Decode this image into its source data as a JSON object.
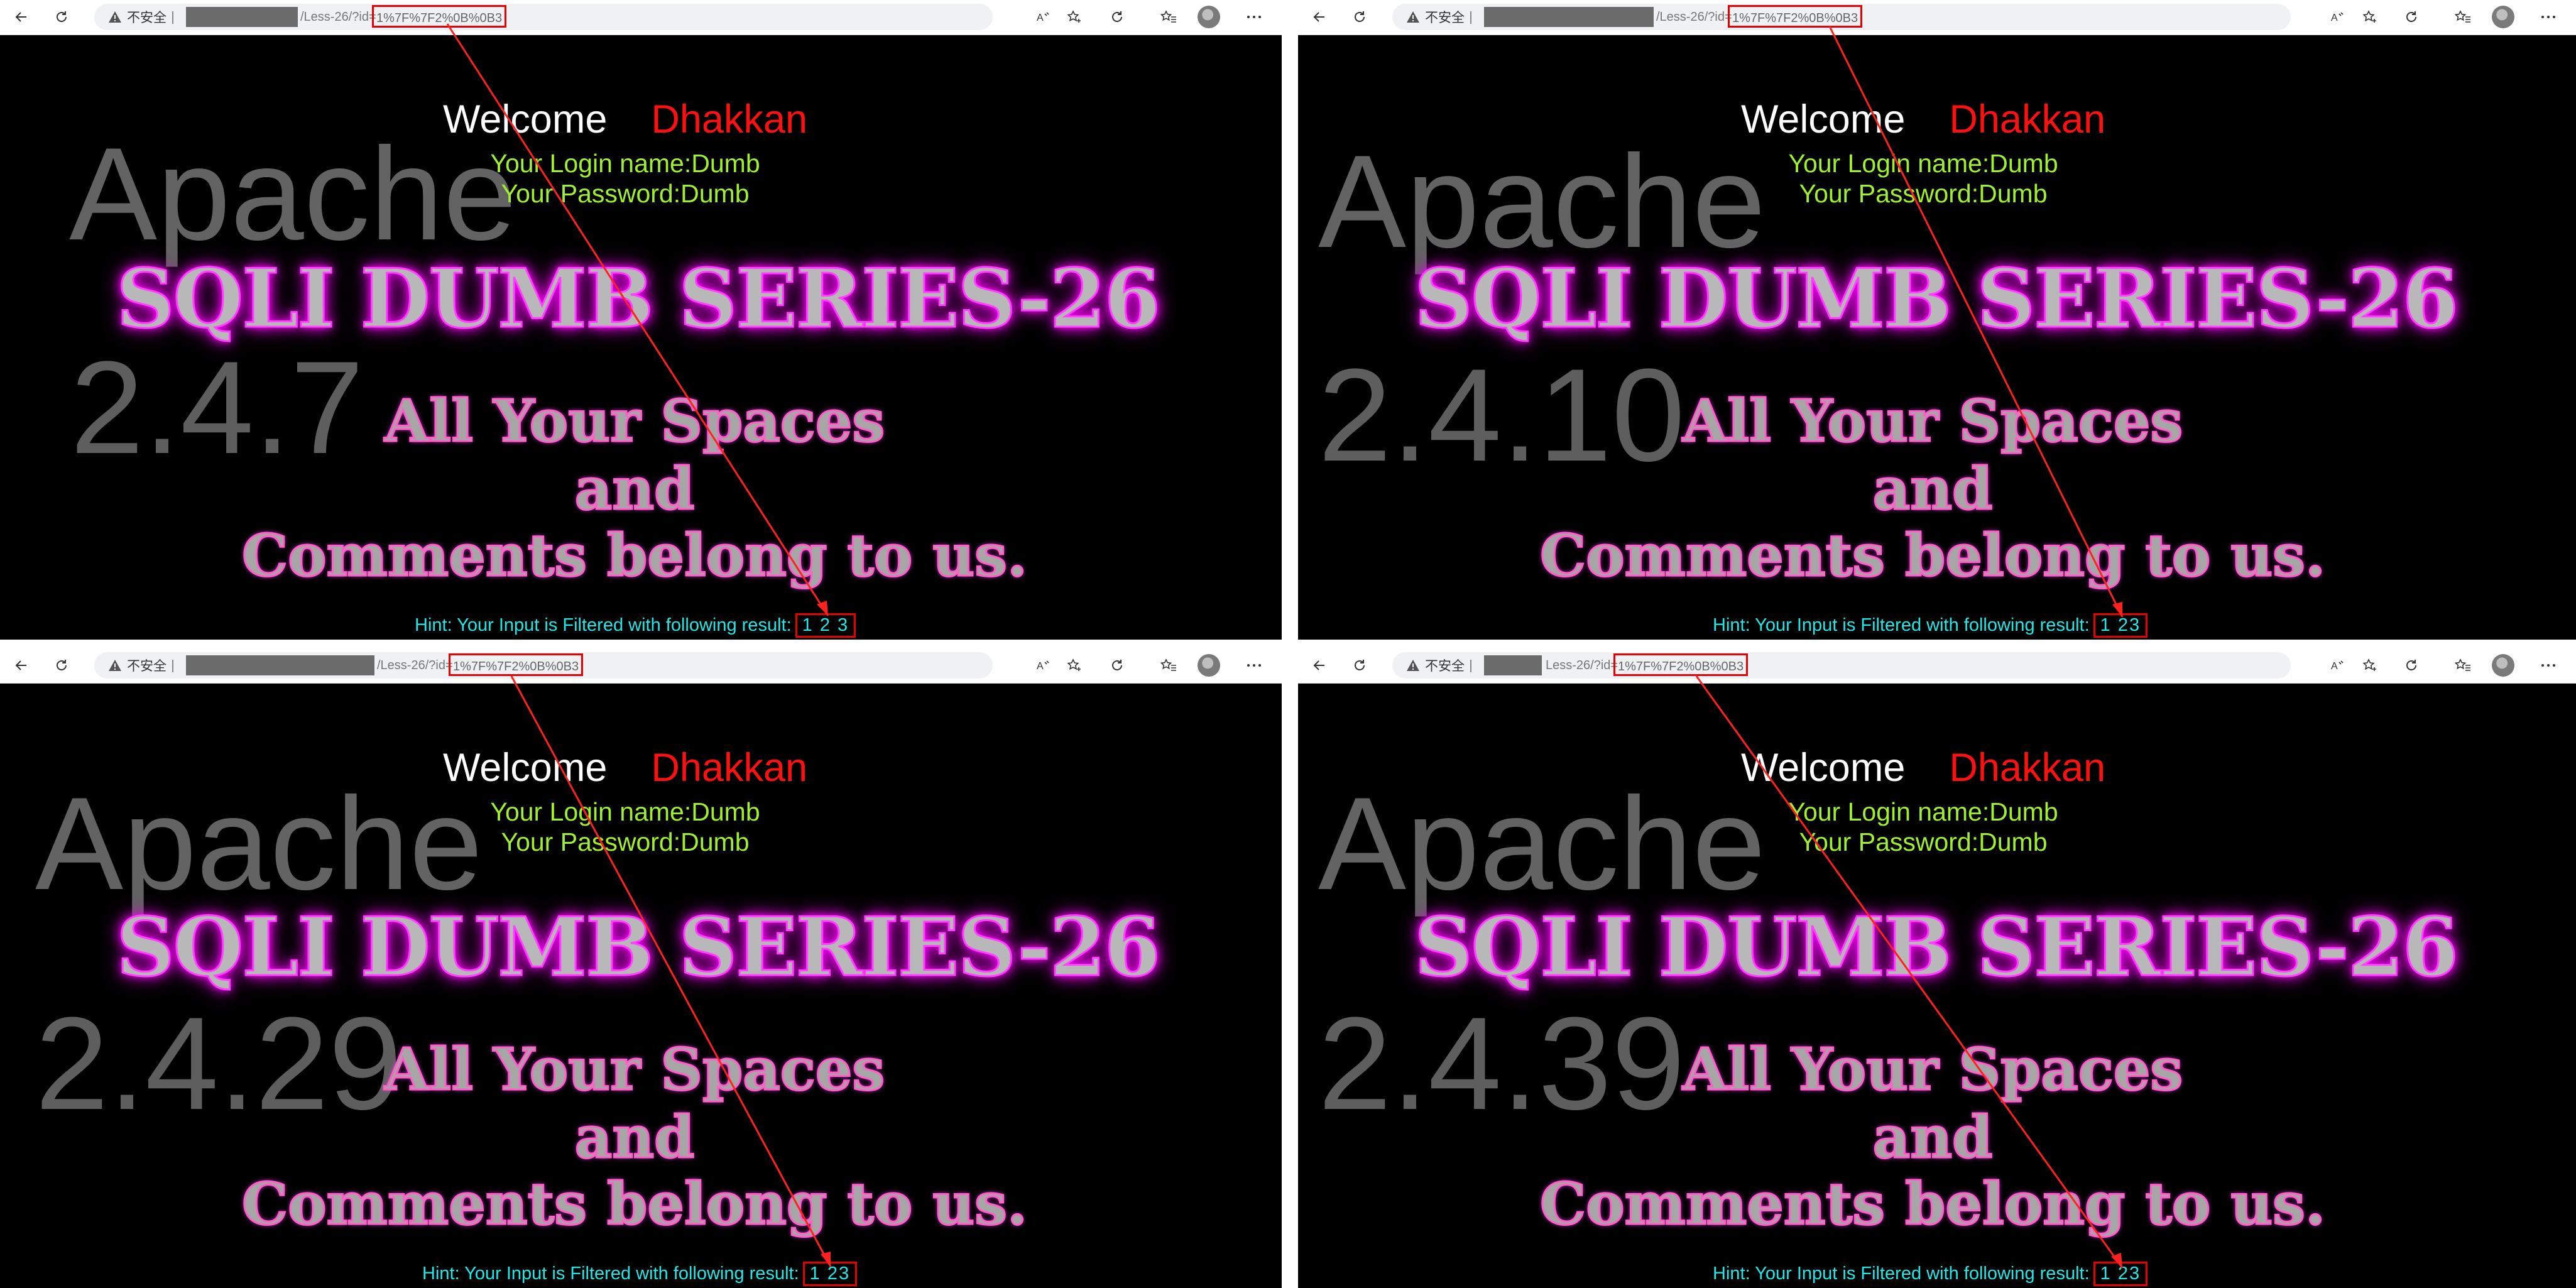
{
  "chrome": {
    "insecure_label": "不安全",
    "url_id": "1%7F%7F2%0B%0B3"
  },
  "panels": [
    {
      "url_path": "/Less-26/?id=",
      "welcome": "Welcome",
      "name": "Dhakkan",
      "login": "Your Login name:Dumb",
      "password": "Your Password:Dumb",
      "apache": "Apache",
      "version": "2.4.7",
      "title": "SQLI DUMB SERIES-26",
      "line1": "All Your Spaces",
      "line2": "and",
      "line3": "Comments belong to us.",
      "hint": "Hint: Your Input is Filtered with following result:",
      "result": "1 2 3"
    },
    {
      "url_path": "/Less-26/?id=",
      "welcome": "Welcome",
      "name": "Dhakkan",
      "login": "Your Login name:Dumb",
      "password": "Your Password:Dumb",
      "apache": "Apache",
      "version": "2.4.10",
      "title": "SQLI DUMB SERIES-26",
      "line1": "All Your Spaces",
      "line2": "and",
      "line3": "Comments belong to us.",
      "hint": "Hint: Your Input is Filtered with following result:",
      "result": "1 23"
    },
    {
      "url_path": "/Less-26/?id=",
      "welcome": "Welcome",
      "name": "Dhakkan",
      "login": "Your Login name:Dumb",
      "password": "Your Password:Dumb",
      "apache": "Apache",
      "version": "2.4.29",
      "title": "SQLI DUMB SERIES-26",
      "line1": "All Your Spaces",
      "line2": "and",
      "line3": "Comments belong to us.",
      "hint": "Hint: Your Input is Filtered with following result:",
      "result": "1 23"
    },
    {
      "url_path": "Less-26/?id=",
      "welcome": "Welcome",
      "name": "Dhakkan",
      "login": "Your Login name:Dumb",
      "password": "Your Password:Dumb",
      "apache": "Apache",
      "version": "2.4.39",
      "title": "SQLI DUMB SERIES-26",
      "line1": "All Your Spaces",
      "line2": "and",
      "line3": "Comments belong to us.",
      "hint": "Hint: Your Input is Filtered with following result:",
      "result": "1 23"
    }
  ]
}
